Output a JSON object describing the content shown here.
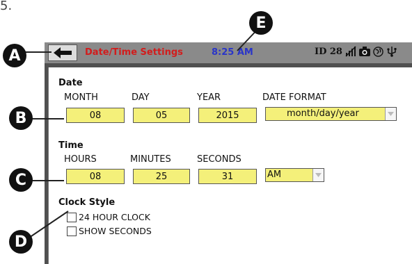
{
  "step_number": "5.",
  "callouts": {
    "a": "A",
    "b": "B",
    "c": "C",
    "d": "D",
    "e": "E"
  },
  "statusbar": {
    "back_icon": "arrow-left-icon",
    "title": "Date/Time Settings",
    "time": "8:25 AM",
    "id_label": "ID 28",
    "icons": [
      "signal-off-icon",
      "camera-icon",
      "globe-icon",
      "usb-icon"
    ],
    "colors": {
      "title": "#d21c1c",
      "time": "#2a35c8",
      "bar": "#8a8a8a"
    }
  },
  "date_section": {
    "title": "Date",
    "month_label": "MONTH",
    "month_value": "08",
    "day_label": "DAY",
    "day_value": "05",
    "year_label": "YEAR",
    "year_value": "2015",
    "format_label": "DATE FORMAT",
    "format_value": "month/day/year"
  },
  "time_section": {
    "title": "Time",
    "hours_label": "HOURS",
    "hours_value": "08",
    "minutes_label": "MINUTES",
    "minutes_value": "25",
    "seconds_label": "SECONDS",
    "seconds_value": "31",
    "ampm_value": "AM"
  },
  "clock_style": {
    "title": "Clock Style",
    "option_24h": "24 HOUR CLOCK",
    "option_24h_checked": false,
    "option_seconds": "SHOW SECONDS",
    "option_seconds_checked": false
  },
  "field_color": "#f4f07a"
}
